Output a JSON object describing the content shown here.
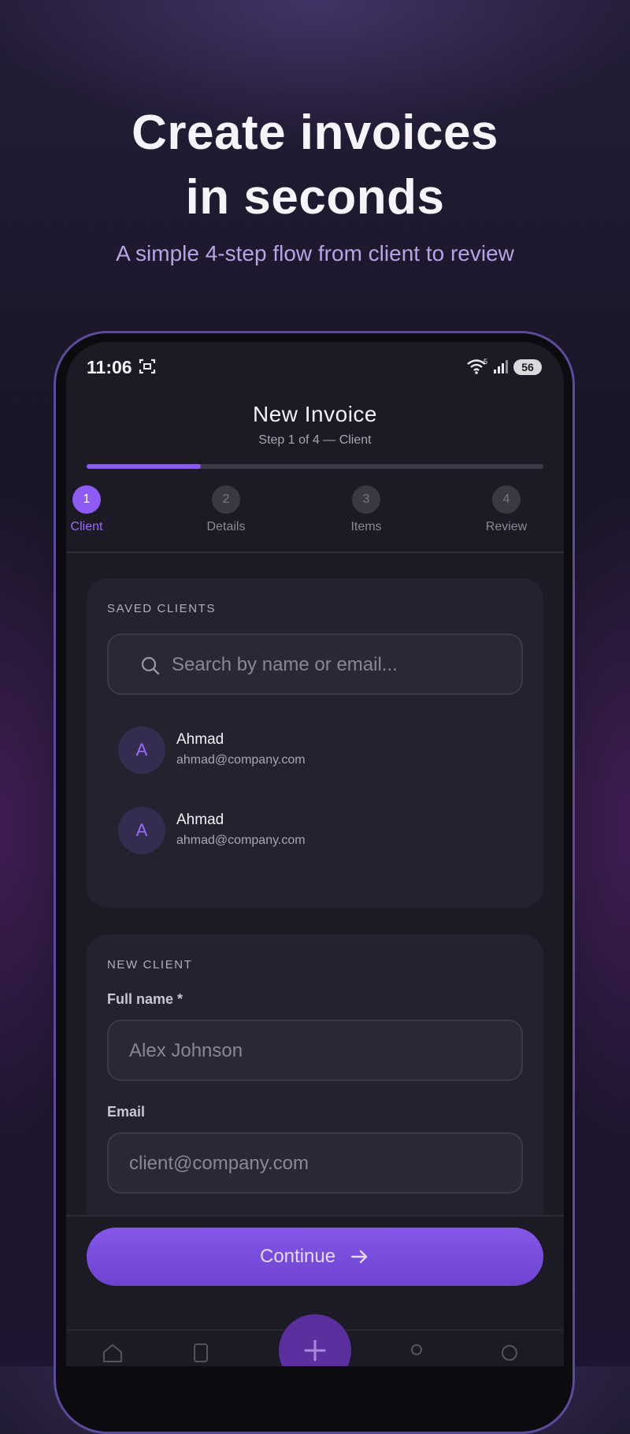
{
  "hero": {
    "title_line1": "Create invoices",
    "title_line2": "in seconds",
    "subtitle": "A simple 4-step flow from client to review"
  },
  "status_bar": {
    "time": "11:06",
    "battery": "56",
    "wifi_badge": "5"
  },
  "header": {
    "title": "New Invoice",
    "step_text": "Step 1 of 4 — Client",
    "progress": 0.25,
    "steps": [
      {
        "number": "1",
        "label": "Client",
        "active": true
      },
      {
        "number": "2",
        "label": "Details",
        "active": false
      },
      {
        "number": "3",
        "label": "Items",
        "active": false
      },
      {
        "number": "4",
        "label": "Review",
        "active": false
      }
    ]
  },
  "saved_clients": {
    "heading": "SAVED CLIENTS",
    "search_placeholder": "Search by name or email...",
    "clients": [
      {
        "initial": "A",
        "name": "Ahmad",
        "email": "ahmad@company.com"
      },
      {
        "initial": "A",
        "name": "Ahmad",
        "email": "ahmad@company.com"
      }
    ]
  },
  "new_client": {
    "heading": "NEW CLIENT",
    "full_name_label": "Full name *",
    "full_name_placeholder": "Alex Johnson",
    "email_label": "Email",
    "email_placeholder": "client@company.com"
  },
  "footer": {
    "continue_label": "Continue"
  },
  "colors": {
    "accent": "#8c5cf2",
    "background": "#1a1628",
    "card": "#25222f"
  },
  "icons": [
    "screenshot-icon",
    "wifi-icon",
    "signal-icon",
    "search-icon",
    "arrow-right-icon",
    "plus-icon"
  ]
}
